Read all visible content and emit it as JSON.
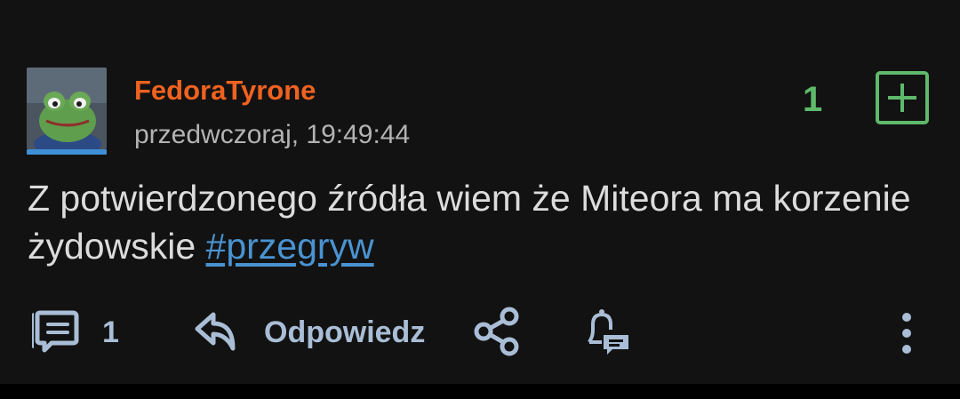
{
  "post": {
    "author": "FedoraTyrone",
    "timestamp": "przedwczoraj, 19:49:44",
    "vote_count": "1",
    "vote_button_icon": "plus-square-icon",
    "body": "Z potwierdzonego źródła wiem że Miteora ma korzenie żydowskie",
    "tag": "#przegryw"
  },
  "actions": {
    "comments_icon": "comments-icon",
    "comments_count": "1",
    "reply_icon": "reply-arrow-icon",
    "reply_label": "Odpowiedz",
    "share_icon": "share-icon",
    "notify_icon": "bell-comment-icon",
    "more_icon": "more-vertical-icon"
  },
  "colors": {
    "background": "#121212",
    "author": "#f0621f",
    "vote": "#5fb96b",
    "tag": "#4a93d1",
    "action": "#a9bed6"
  }
}
